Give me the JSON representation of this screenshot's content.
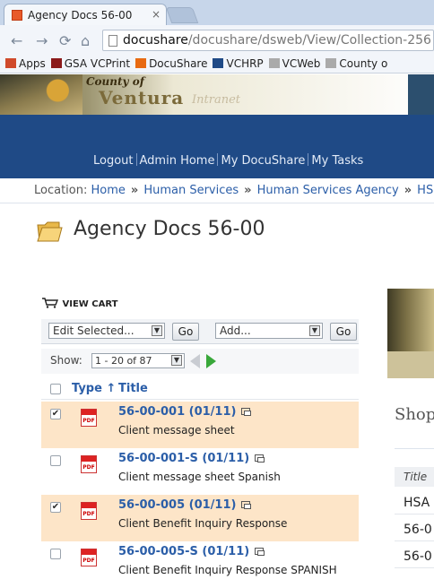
{
  "browser": {
    "tab_title": "Agency Docs 56-00",
    "tab_close": "×",
    "url_host": "docushare",
    "url_path": "/docushare/dsweb/View/Collection-256",
    "bookmarks": [
      {
        "label": "Apps",
        "icon": "apps-icon",
        "color": "#d04a2b"
      },
      {
        "label": "GSA VCPrint",
        "icon": "rsa-icon",
        "color": "#8b1a1a"
      },
      {
        "label": "DocuShare",
        "icon": "docushare-icon",
        "color": "#e86a12"
      },
      {
        "label": "VCHRP",
        "icon": "p-icon",
        "color": "#1f4a86"
      },
      {
        "label": "VCWeb",
        "icon": "page-icon",
        "color": "#aaaaaa"
      },
      {
        "label": "County o",
        "icon": "page-icon",
        "color": "#aaaaaa"
      }
    ]
  },
  "banner": {
    "county_of": "County of",
    "ventura": "Ventura",
    "intranet": "Intranet",
    "links": [
      "Logout",
      "Admin Home",
      "My DocuShare",
      "My Tasks"
    ]
  },
  "breadcrumb": {
    "label": "Location:",
    "items": [
      "Home",
      "Human Services",
      "Human Services Agency",
      "HS"
    ]
  },
  "page": {
    "title": "Agency Docs 56-00"
  },
  "toolbar": {
    "view_cart": "VIEW CART",
    "edit_selected": "Edit Selected...",
    "go1": "Go",
    "add": "Add...",
    "go2": "Go",
    "show_label": "Show:",
    "range": "1 - 20 of 87"
  },
  "table": {
    "col_type": "Type ↑",
    "col_title": "Title",
    "rows": [
      {
        "name": "56-00-001 (01/11)",
        "desc": "Client message sheet",
        "checked": true
      },
      {
        "name": "56-00-001-S (01/11)",
        "desc": "Client message sheet Spanish",
        "checked": false
      },
      {
        "name": "56-00-005 (01/11)",
        "desc": "Client Benefit Inquiry Response",
        "checked": true
      },
      {
        "name": "56-00-005-S (01/11)",
        "desc": "Client Benefit Inquiry Response SPANISH",
        "checked": false
      }
    ]
  },
  "right_panel": {
    "heading": "Shop",
    "col_title": "Title",
    "cells": [
      "HSA",
      "56-0",
      "56-0"
    ]
  },
  "colors": {
    "banner_blue": "#1f4a86",
    "link_blue": "#2b5ea8",
    "selected_row": "#fde5c8"
  }
}
